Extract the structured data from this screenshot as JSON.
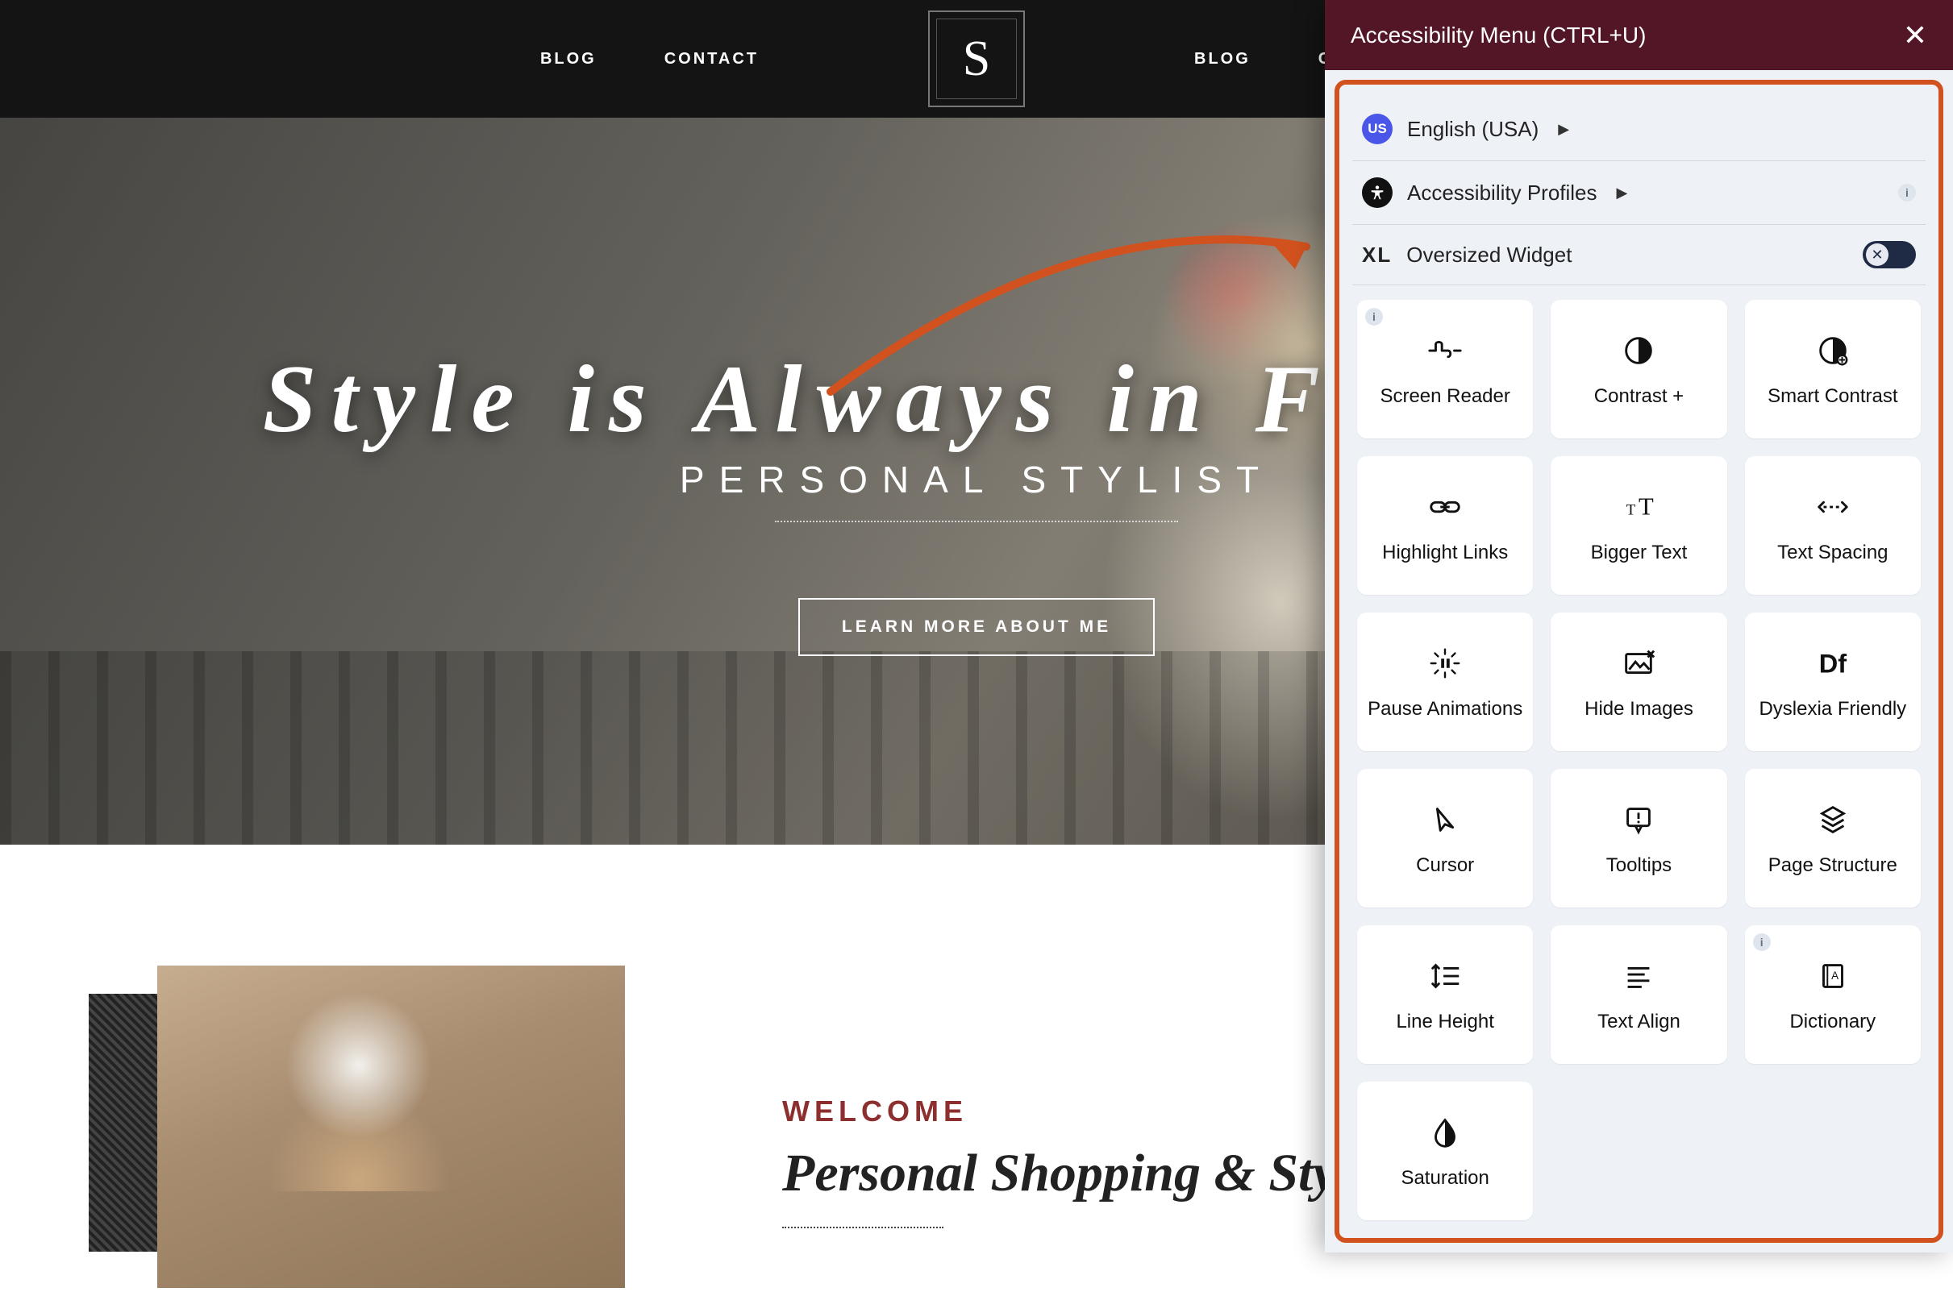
{
  "nav": {
    "left": [
      "BLOG",
      "CONTACT"
    ],
    "right": [
      "BLOG",
      "CONTACT"
    ],
    "logo_letter": "S"
  },
  "hero": {
    "title": "Style is Always in Fashion",
    "subtitle": "PERSONAL STYLIST",
    "cta": "LEARN MORE ABOUT ME"
  },
  "welcome": {
    "label": "WELCOME",
    "headline": "Personal Shopping & Styling"
  },
  "a11y": {
    "header": "Accessibility Menu (CTRL+U)",
    "language": {
      "badge": "US",
      "label": "English (USA)"
    },
    "profiles_label": "Accessibility Profiles",
    "oversized_label": "Oversized Widget",
    "oversized_on": false,
    "tiles": [
      {
        "id": "screen-reader",
        "label": "Screen Reader",
        "info_left": true
      },
      {
        "id": "contrast-plus",
        "label": "Contrast +"
      },
      {
        "id": "smart-contrast",
        "label": "Smart Contrast"
      },
      {
        "id": "highlight-links",
        "label": "Highlight Links"
      },
      {
        "id": "bigger-text",
        "label": "Bigger Text"
      },
      {
        "id": "text-spacing",
        "label": "Text Spacing"
      },
      {
        "id": "pause-animations",
        "label": "Pause Animations"
      },
      {
        "id": "hide-images",
        "label": "Hide Images"
      },
      {
        "id": "dyslexia-friendly",
        "label": "Dyslexia Friendly"
      },
      {
        "id": "cursor",
        "label": "Cursor"
      },
      {
        "id": "tooltips",
        "label": "Tooltips"
      },
      {
        "id": "page-structure",
        "label": "Page Structure"
      },
      {
        "id": "line-height",
        "label": "Line Height"
      },
      {
        "id": "text-align",
        "label": "Text Align"
      },
      {
        "id": "dictionary",
        "label": "Dictionary",
        "info_left": true
      },
      {
        "id": "saturation",
        "label": "Saturation"
      }
    ]
  },
  "colors": {
    "panel_header": "#521626",
    "panel_bg": "#eef2f7",
    "panel_border": "#d1521e",
    "welcome_accent": "#8d2f2f"
  }
}
